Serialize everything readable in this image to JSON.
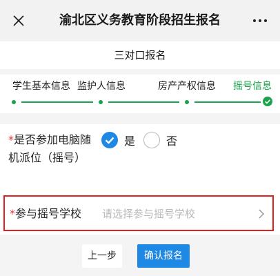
{
  "header": {
    "title": "渝北区义务教育阶段招生报名",
    "close_icon": "close-icon",
    "more_icon": "more-icon"
  },
  "subtitle": "三对口报名",
  "steps": [
    {
      "label": "学生基本信息",
      "active": false
    },
    {
      "label": "监护人信息",
      "active": false
    },
    {
      "label": "房产产权信息",
      "active": false
    },
    {
      "label": "摇号信息",
      "active": true
    }
  ],
  "form": {
    "lottery": {
      "required_mark": "*",
      "label": "是否参加电脑随机派位（摇号）",
      "options": [
        {
          "label": "是",
          "checked": true
        },
        {
          "label": "否",
          "checked": false
        }
      ]
    },
    "school": {
      "required_mark": "*",
      "label": "参与摇号学校",
      "placeholder": "请选择参与摇号学校"
    }
  },
  "buttons": {
    "prev": "上一步",
    "confirm": "确认报名"
  },
  "colors": {
    "accent_green": "#1aa34a",
    "primary_blue": "#1e88e5",
    "required_red": "#e8343c",
    "highlight_red": "#e02020"
  }
}
